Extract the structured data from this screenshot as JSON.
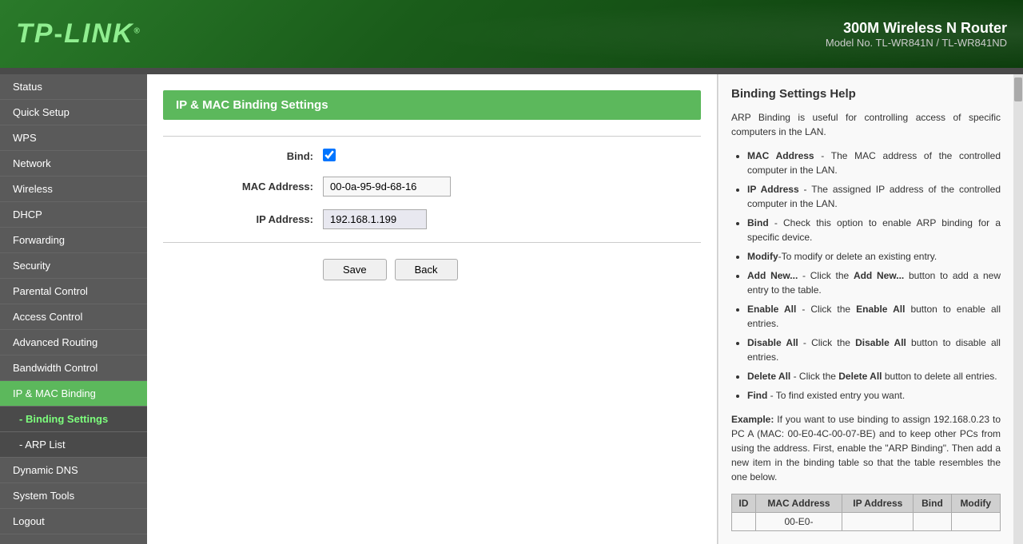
{
  "header": {
    "logo": "TP-LINK",
    "product_name": "300M Wireless N Router",
    "model_number": "Model No. TL-WR841N / TL-WR841ND"
  },
  "sidebar": {
    "items": [
      {
        "label": "Status",
        "id": "status",
        "active": false,
        "sub": false
      },
      {
        "label": "Quick Setup",
        "id": "quick-setup",
        "active": false,
        "sub": false
      },
      {
        "label": "WPS",
        "id": "wps",
        "active": false,
        "sub": false
      },
      {
        "label": "Network",
        "id": "network",
        "active": false,
        "sub": false
      },
      {
        "label": "Wireless",
        "id": "wireless",
        "active": false,
        "sub": false
      },
      {
        "label": "DHCP",
        "id": "dhcp",
        "active": false,
        "sub": false
      },
      {
        "label": "Forwarding",
        "id": "forwarding",
        "active": false,
        "sub": false
      },
      {
        "label": "Security",
        "id": "security",
        "active": false,
        "sub": false
      },
      {
        "label": "Parental Control",
        "id": "parental-control",
        "active": false,
        "sub": false
      },
      {
        "label": "Access Control",
        "id": "access-control",
        "active": false,
        "sub": false
      },
      {
        "label": "Advanced Routing",
        "id": "advanced-routing",
        "active": false,
        "sub": false
      },
      {
        "label": "Bandwidth Control",
        "id": "bandwidth-control",
        "active": false,
        "sub": false
      },
      {
        "label": "IP & MAC Binding",
        "id": "ip-mac-binding",
        "active": true,
        "sub": false
      },
      {
        "label": "- Binding Settings",
        "id": "binding-settings",
        "active": true,
        "sub": true
      },
      {
        "label": "- ARP List",
        "id": "arp-list",
        "active": false,
        "sub": true
      },
      {
        "label": "Dynamic DNS",
        "id": "dynamic-dns",
        "active": false,
        "sub": false
      },
      {
        "label": "System Tools",
        "id": "system-tools",
        "active": false,
        "sub": false
      },
      {
        "label": "Logout",
        "id": "logout",
        "active": false,
        "sub": false
      }
    ]
  },
  "main": {
    "section_title": "IP & MAC Binding Settings",
    "form": {
      "bind_label": "Bind:",
      "mac_label": "MAC Address:",
      "ip_label": "IP Address:",
      "mac_value": "00-0a-95-9d-68-16",
      "ip_value": "192.168.1.199",
      "bind_checked": true
    },
    "buttons": {
      "save": "Save",
      "back": "Back"
    }
  },
  "help": {
    "title": "Binding Settings Help",
    "intro": "ARP Binding is useful for controlling access of specific computers in the LAN.",
    "items": [
      {
        "term": "MAC Address",
        "desc": " - The MAC address of the controlled computer in the LAN."
      },
      {
        "term": "IP Address",
        "desc": " - The assigned IP address of the controlled computer in the LAN."
      },
      {
        "term": "Bind",
        "desc": " - Check this option to enable ARP binding for a specific device."
      },
      {
        "term": "Modify",
        "desc": "-To modify or delete an existing entry."
      },
      {
        "term": "Add New...",
        "desc": " - Click the Add New... button to add a new entry to the table."
      },
      {
        "term": "Enable All",
        "desc": " - Click the Enable All button to enable all entries."
      },
      {
        "term": "Disable All",
        "desc": " - Click the Disable All button to disable all entries."
      },
      {
        "term": "Delete All",
        "desc": " - Click the Delete All button to delete all entries."
      },
      {
        "term": "Find",
        "desc": " - To find existed entry you want."
      }
    ],
    "example_text": "If you want to use binding to assign 192.168.0.23 to PC A (MAC: 00-E0-4C-00-07-BE) and to keep other PCs from using the address. First, enable the \"ARP Binding\". Then add a new item in the binding table so that the table resembles the one below.",
    "table_headers": [
      "ID",
      "MAC Address",
      "IP Address",
      "Bind",
      "Modify"
    ],
    "table_rows": [
      {
        "id": "",
        "mac": "00-E0-",
        "ip": "",
        "bind": "",
        "modify": ""
      }
    ]
  }
}
